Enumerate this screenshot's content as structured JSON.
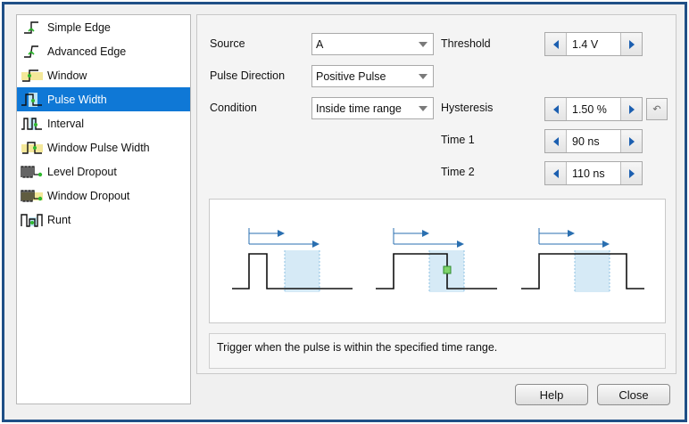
{
  "triggers": [
    {
      "label": "Simple Edge",
      "icon": "simple-edge-icon"
    },
    {
      "label": "Advanced Edge",
      "icon": "advanced-edge-icon"
    },
    {
      "label": "Window",
      "icon": "window-icon"
    },
    {
      "label": "Pulse Width",
      "icon": "pulse-width-icon",
      "selected": true
    },
    {
      "label": "Interval",
      "icon": "interval-icon"
    },
    {
      "label": "Window Pulse Width",
      "icon": "window-pulse-width-icon"
    },
    {
      "label": "Level Dropout",
      "icon": "level-dropout-icon"
    },
    {
      "label": "Window Dropout",
      "icon": "window-dropout-icon"
    },
    {
      "label": "Runt",
      "icon": "runt-icon"
    }
  ],
  "settings": {
    "source": {
      "label": "Source",
      "value": "A"
    },
    "pulse_direction": {
      "label": "Pulse Direction",
      "value": "Positive Pulse"
    },
    "condition": {
      "label": "Condition",
      "value": "Inside time range"
    },
    "threshold": {
      "label": "Threshold",
      "value": "1.4 V"
    },
    "hysteresis": {
      "label": "Hysteresis",
      "value": "1.50 %"
    },
    "time1": {
      "label": "Time 1",
      "value": "90 ns"
    },
    "time2": {
      "label": "Time 2",
      "value": "110 ns"
    }
  },
  "description": "Trigger when the pulse is within the specified time range.",
  "buttons": {
    "help": "Help",
    "close": "Close"
  },
  "colors": {
    "selection": "#0f78d6",
    "frame": "#1f4f86",
    "spin_arrow": "#1c5fb0",
    "time_window": "#d6eaf6",
    "arrow_line": "#2a6fb0",
    "trigger_point": "#7fd36a",
    "icon_green": "#2eb82e",
    "icon_highlight": "#f4e89a"
  }
}
